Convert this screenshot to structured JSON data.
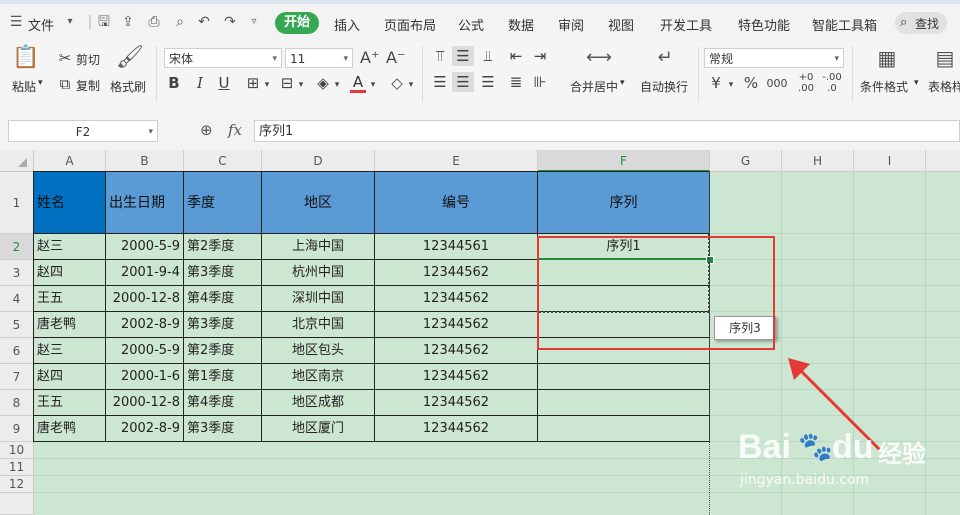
{
  "menu": {
    "file_label": "文件",
    "tabs": [
      "开始",
      "插入",
      "页面布局",
      "公式",
      "数据",
      "审阅",
      "视图",
      "开发工具",
      "特色功能",
      "智能工具箱"
    ],
    "search_label": "查找"
  },
  "ribbon": {
    "paste": "粘贴",
    "cut": "剪切",
    "copy": "复制",
    "format_painter": "格式刷",
    "font_name": "宋体",
    "font_size": "11",
    "merge_center": "合并居中",
    "wrap_text": "自动换行",
    "number_format": "常规",
    "conditional_format": "条件格式",
    "table_style": "表格样",
    "bold": "B",
    "italic": "I",
    "underline": "U",
    "percent": "%",
    "thousands": "000",
    "inc_decimal": "+0\n.00",
    "dec_decimal": "-.00\n.0"
  },
  "formula_bar": {
    "name_box": "F2",
    "fx": "fx",
    "content": "序列1"
  },
  "sheet": {
    "columns": [
      "A",
      "B",
      "C",
      "D",
      "E",
      "F",
      "G",
      "H",
      "I"
    ],
    "rows": [
      "1",
      "2",
      "3",
      "4",
      "5",
      "6",
      "7",
      "8",
      "9",
      "10",
      "11",
      "12"
    ],
    "header": [
      "姓名",
      "出生日期",
      "季度",
      "地区",
      "编号",
      "序列"
    ],
    "data": [
      [
        "赵三",
        "2000-5-9",
        "第2季度",
        "上海中国",
        "12344561",
        "序列1"
      ],
      [
        "赵四",
        "2001-9-4",
        "第3季度",
        "杭州中国",
        "12344562",
        ""
      ],
      [
        "王五",
        "2000-12-8",
        "第4季度",
        "深圳中国",
        "12344562",
        ""
      ],
      [
        "唐老鸭",
        "2002-8-9",
        "第3季度",
        "北京中国",
        "12344562",
        ""
      ],
      [
        "赵三",
        "2000-5-9",
        "第2季度",
        "地区包头",
        "12344562",
        ""
      ],
      [
        "赵四",
        "2000-1-6",
        "第1季度",
        "地区南京",
        "12344562",
        ""
      ],
      [
        "王五",
        "2000-12-8",
        "第4季度",
        "地区成都",
        "12344562",
        ""
      ],
      [
        "唐老鸭",
        "2002-8-9",
        "第3季度",
        "地区厦门",
        "12344562",
        ""
      ]
    ],
    "fill_tooltip": "序列3"
  },
  "watermark": {
    "brand": "Bai",
    "brand2": "du",
    "cn": "经验",
    "url": "jingyan.baidu.com"
  },
  "colors": {
    "accent_green": "#34a853",
    "header_blue": "#5b9bd5",
    "selected_blue": "#0070c0",
    "sheet_bg": "#cde6d1",
    "annotation_red": "#e53935"
  }
}
